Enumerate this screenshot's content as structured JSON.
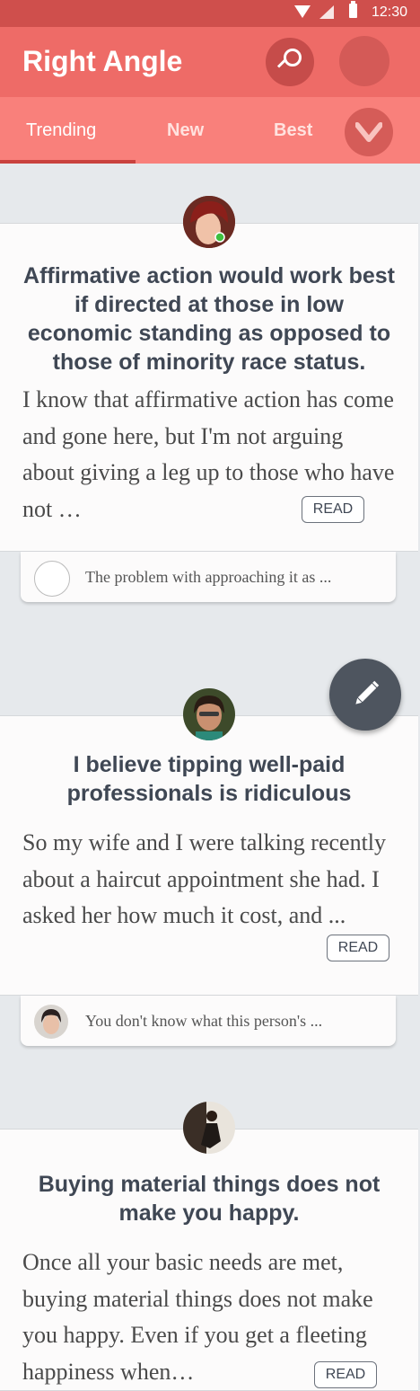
{
  "status_bar": {
    "time": "12:30"
  },
  "app_bar": {
    "title": "Right Angle"
  },
  "tabs": [
    {
      "label": "Trending"
    },
    {
      "label": "New"
    },
    {
      "label": "Best"
    }
  ],
  "posts": [
    {
      "title": "Affirmative action would work best if directed at those in low economic standing as opposed to those of minority race status.",
      "body": "I know that affirmative action has come and gone here, but I'm not arguing about giving a leg up to those who have not …",
      "read_label": "READ",
      "comment": "The problem with approaching it as ..."
    },
    {
      "title": "I believe tipping well-paid professionals is ridiculous",
      "body": "So my wife and I were talking recently about a haircut appointment she had. I asked her how much it cost, and  ...",
      "read_label": "READ",
      "comment": "You don't know what this person's ..."
    },
    {
      "title": "Buying material things does not make you happy.",
      "body": "Once all your basic needs are met, buying material things does not make you happy. Even if you get a fleeting happiness when…",
      "read_label": "READ"
    }
  ]
}
